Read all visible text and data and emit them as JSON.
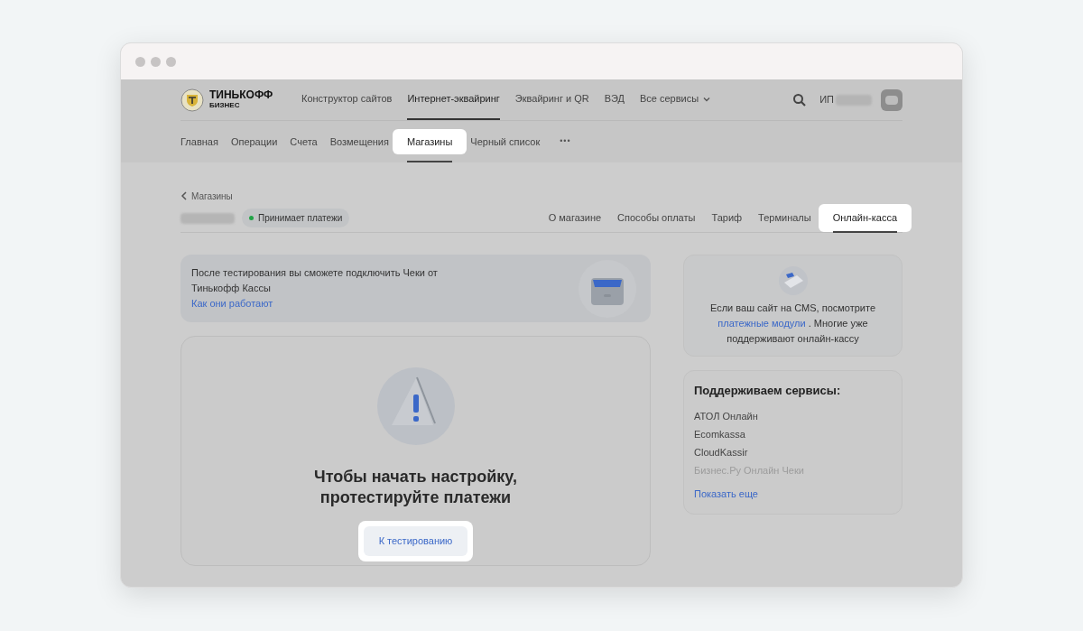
{
  "logo": {
    "line1": "ТИНЬКОФФ",
    "line2": "БИЗНЕС"
  },
  "top_nav": [
    {
      "label": "Конструктор сайтов",
      "selected": false,
      "dropdown": false
    },
    {
      "label": "Интернет-эквайринг",
      "selected": true,
      "dropdown": false
    },
    {
      "label": "Эквайринг и QR",
      "selected": false,
      "dropdown": false
    },
    {
      "label": "ВЭД",
      "selected": false,
      "dropdown": false
    },
    {
      "label": "Все сервисы",
      "selected": false,
      "dropdown": true
    }
  ],
  "account": {
    "prefix": "ИП"
  },
  "sub_nav": [
    {
      "label": "Главная",
      "selected": false
    },
    {
      "label": "Операции",
      "selected": false
    },
    {
      "label": "Счета",
      "selected": false
    },
    {
      "label": "Возмещения",
      "selected": false
    },
    {
      "label": "Магазины",
      "selected": true
    },
    {
      "label": "Черный список",
      "selected": false
    }
  ],
  "more": "•••",
  "breadcrumb": "Магазины",
  "status": {
    "label": "Принимает платежи",
    "color": "#22a447"
  },
  "store_tabs": [
    {
      "label": "О магазине",
      "selected": false
    },
    {
      "label": "Способы оплаты",
      "selected": false
    },
    {
      "label": "Тариф",
      "selected": false
    },
    {
      "label": "Терминалы",
      "selected": false
    },
    {
      "label": "Онлайн-касса",
      "selected": true
    }
  ],
  "banner": {
    "text": "После тестирования вы сможете подключить Чеки от Тинькофф Кассы",
    "link": "Как они работают"
  },
  "empty_state": {
    "title_lines": [
      "Чтобы начать настройку,",
      "протестируйте платежи"
    ],
    "button": "К тестированию"
  },
  "cms_card": {
    "before": "Если ваш сайт на CMS, посмотрите",
    "link": "платежные модули",
    "after": ". Многие уже поддерживают онлайн-кассу"
  },
  "services": {
    "title": "Поддерживаем сервисы:",
    "items": [
      {
        "label": "АТОЛ Онлайн",
        "faded": false
      },
      {
        "label": "Ecomkassa",
        "faded": false
      },
      {
        "label": "CloudKassir",
        "faded": false
      },
      {
        "label": "Бизнес.Ру Онлайн Чеки",
        "faded": true
      }
    ],
    "show_more": "Показать еще"
  }
}
